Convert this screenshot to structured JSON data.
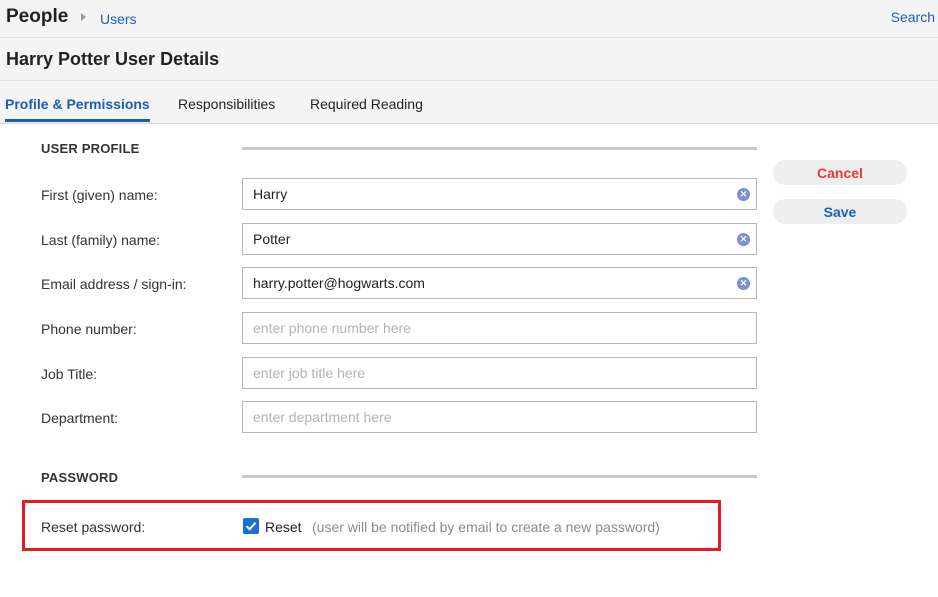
{
  "header": {
    "app_title": "People",
    "breadcrumb": "Users",
    "search_link": "Search"
  },
  "page_title": "Harry Potter User Details",
  "tabs": [
    {
      "label": "Profile & Permissions",
      "active": true
    },
    {
      "label": "Responsibilities",
      "active": false
    },
    {
      "label": "Required Reading",
      "active": false
    }
  ],
  "user_profile": {
    "section_label": "USER PROFILE",
    "fields": [
      {
        "label": "First (given) name:",
        "value": "Harry",
        "placeholder": ""
      },
      {
        "label": "Last (family) name:",
        "value": "Potter",
        "placeholder": ""
      },
      {
        "label": "Email address / sign-in:",
        "value": "harry.potter@hogwarts.com",
        "placeholder": ""
      },
      {
        "label": "Phone number:",
        "value": "",
        "placeholder": "enter phone number here"
      },
      {
        "label": "Job Title:",
        "value": "",
        "placeholder": "enter job title here"
      },
      {
        "label": "Department:",
        "value": "",
        "placeholder": "enter department here"
      }
    ]
  },
  "actions": {
    "cancel_label": "Cancel",
    "save_label": "Save"
  },
  "password": {
    "section_label": "PASSWORD",
    "reset_label": "Reset password:",
    "reset_checked": true,
    "reset_option": "Reset",
    "reset_hint": "(user will be notified by email to create a new password)"
  },
  "colors": {
    "accent": "#1a5fb4",
    "cancel": "#e53935",
    "highlight": "#e41b23"
  }
}
